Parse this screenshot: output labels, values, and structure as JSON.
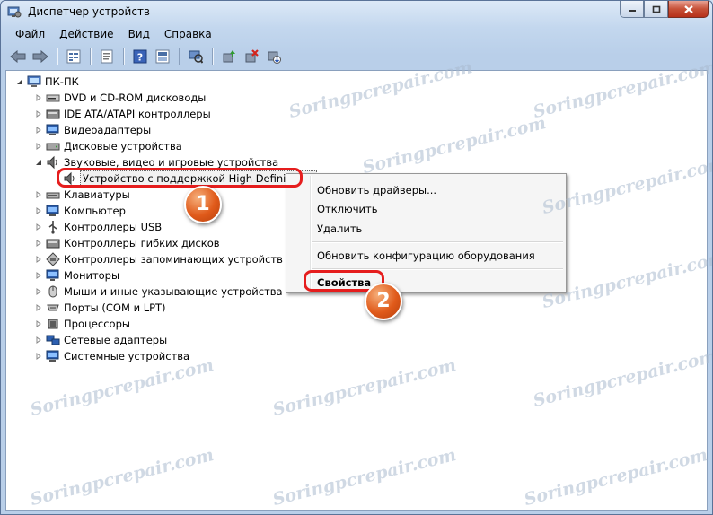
{
  "window": {
    "title": "Диспетчер устройств",
    "controls": {
      "minimize": "▁",
      "maximize": "□",
      "close": "✕"
    }
  },
  "menu": [
    "Файл",
    "Действие",
    "Вид",
    "Справка"
  ],
  "toolbar": {
    "icons": [
      "back-arrow-icon",
      "forward-arrow-icon",
      "tree-view-icon",
      "properties-icon",
      "help-icon",
      "show-hidden-icon",
      "scan-hardware-icon",
      "update-driver-icon",
      "uninstall-icon",
      "disable-icon"
    ]
  },
  "tree": {
    "root": "ПК-ПК",
    "items": [
      "DVD и CD-ROM дисководы",
      "IDE ATA/ATAPI контроллеры",
      "Видеоадаптеры",
      "Дисковые устройства",
      "Звуковые, видео и игровые устройства",
      "Устройство с поддержкой High Definition Audio",
      "Клавиатуры",
      "Компьютер",
      "Контроллеры USB",
      "Контроллеры гибких дисков",
      "Контроллеры запоминающих устройств",
      "Мониторы",
      "Мыши и иные указывающие устройства",
      "Порты (COM и LPT)",
      "Процессоры",
      "Сетевые адаптеры",
      "Системные устройства"
    ]
  },
  "context_menu": {
    "update_drivers": "Обновить драйверы...",
    "disable": "Отключить",
    "delete": "Удалить",
    "scan_hardware": "Обновить конфигурацию оборудования",
    "properties": "Свойства"
  },
  "badges": {
    "first": "1",
    "second": "2"
  },
  "watermark": "Soringpcrepair.com",
  "colors": {
    "highlight": "#e51d1d",
    "badge": "#e05a1a"
  }
}
